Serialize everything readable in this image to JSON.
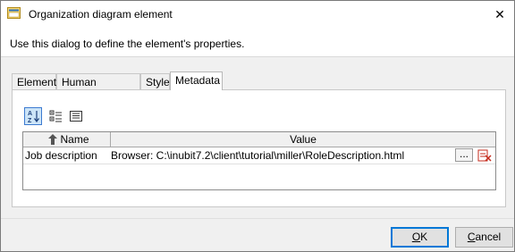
{
  "window": {
    "title": "Organization diagram element",
    "close_symbol": "✕"
  },
  "description": "Use this dialog to define the element's properties.",
  "tabs": [
    {
      "label": "Element"
    },
    {
      "label": "Human resources"
    },
    {
      "label": "Style"
    },
    {
      "label": "Metadata",
      "active": true
    }
  ],
  "toolbar": {
    "icons": [
      "sort-alphabetical-icon",
      "categorized-view-icon",
      "list-view-icon"
    ]
  },
  "table": {
    "columns": [
      "Name",
      "Value"
    ],
    "rows": [
      {
        "name": "Job description",
        "value": "Browser: C:\\inubit7.2\\client\\tutorial\\miller\\RoleDescription.html",
        "ellipsis": "..."
      }
    ]
  },
  "buttons": {
    "ok_first": "O",
    "ok_rest": "K",
    "cancel_first": "C",
    "cancel_rest": "ancel"
  },
  "colors": {
    "accent": "#0078d7",
    "selected_tool_bg": "#cce4f7",
    "delete_icon_red": "#c42b1c"
  }
}
